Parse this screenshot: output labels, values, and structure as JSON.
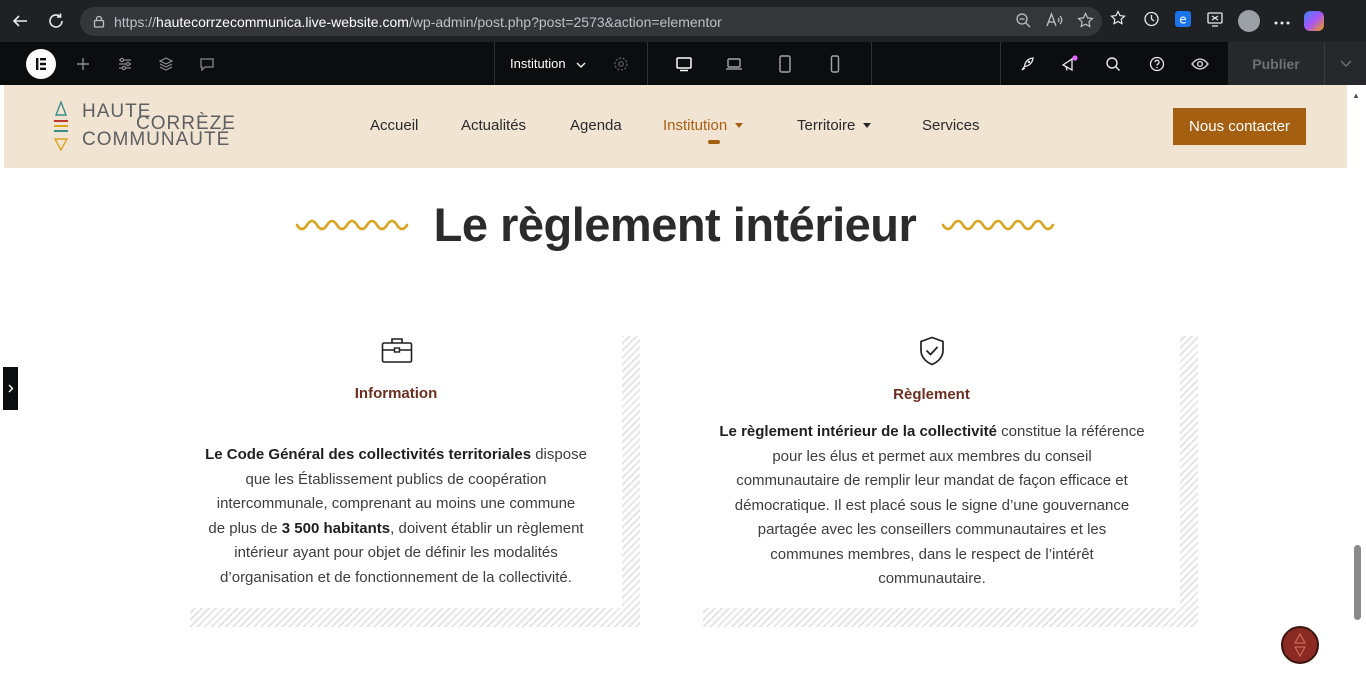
{
  "browser": {
    "url_prefix": "https://",
    "url_domain": "hautecorrzecommunica.live-website.com",
    "url_path": "/wp-admin/post.php?post=2573&action=elementor"
  },
  "editor": {
    "page_name": "Institution",
    "publish_label": "Publier"
  },
  "site": {
    "logo": {
      "line1": "HAUTE",
      "line2": "CORRÈZE",
      "line3": "COMMUNAUTÉ"
    },
    "menu": [
      {
        "label": "Accueil"
      },
      {
        "label": "Actualités"
      },
      {
        "label": "Agenda"
      },
      {
        "label": "Institution"
      },
      {
        "label": "Territoire"
      },
      {
        "label": "Services"
      }
    ],
    "contact_label": "Nous contacter"
  },
  "page": {
    "title": "Le règlement intérieur",
    "cards": [
      {
        "title": "Information",
        "lines": [
          {
            "bold": "Le Code Général des collectivités territoriales",
            "text": " dispose"
          },
          {
            "bold": "",
            "text": "que les Établissement publics de coopération"
          },
          {
            "bold": "",
            "text": "intercommunale, comprenant au moins une commune"
          },
          {
            "pre": "de plus de ",
            "bold": "3 500 habitants",
            "text": ", doivent établir un règlement"
          },
          {
            "bold": "",
            "text": "intérieur ayant pour objet de définir les modalités"
          },
          {
            "bold": "",
            "text": "d’organisation et de fonctionnement de la collectivité."
          }
        ]
      },
      {
        "title": "Règlement",
        "lines": [
          {
            "bold": "Le règlement intérieur de la collectivité",
            "text": " constitue la référence"
          },
          {
            "bold": "",
            "text": "pour les élus et permet aux membres du conseil"
          },
          {
            "bold": "",
            "text": "communautaire de remplir leur mandat de façon efficace et"
          },
          {
            "bold": "",
            "text": "démocratique. Il est placé sous le signe d’une gouvernance"
          },
          {
            "bold": "",
            "text": "partagée avec les conseillers communautaires et les"
          },
          {
            "bold": "",
            "text": "communes membres, dans le respect de l’intérêt"
          },
          {
            "bold": "",
            "text": "communautaire."
          }
        ]
      }
    ]
  },
  "colors": {
    "header_bg": "#f1e4d3",
    "accent": "#a55f10",
    "card_title": "#6b2f21",
    "squiggle": "#d9a520"
  }
}
